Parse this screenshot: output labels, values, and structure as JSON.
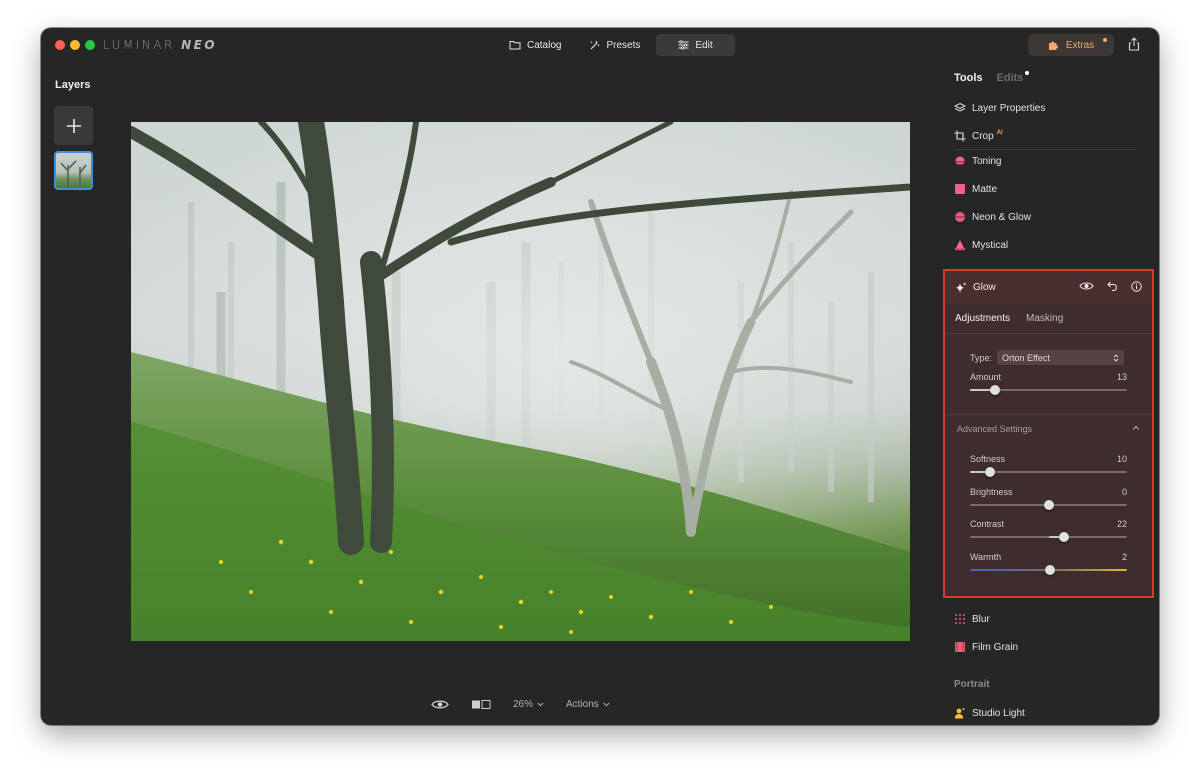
{
  "app": {
    "logo_left": "LUMINAR",
    "logo_right": "NEO"
  },
  "topnav": {
    "catalog": "Catalog",
    "presets": "Presets",
    "edit": "Edit"
  },
  "extras": {
    "label": "Extras"
  },
  "layers": {
    "title": "Layers"
  },
  "view": {
    "zoom": "26%",
    "actions": "Actions"
  },
  "tools_panel": {
    "tab_tools": "Tools",
    "tab_edits": "Edits",
    "items_top": [
      {
        "label": "Layer Properties",
        "icon": "layers-icon"
      },
      {
        "label": "Crop",
        "icon": "crop-icon",
        "badge": "AI"
      },
      {
        "label": "Toning",
        "icon": "toning-icon"
      },
      {
        "label": "Matte",
        "icon": "matte-icon"
      },
      {
        "label": "Neon & Glow",
        "icon": "neon-glow-icon"
      },
      {
        "label": "Mystical",
        "icon": "mystical-icon"
      }
    ],
    "items_bottom": [
      {
        "label": "Blur",
        "icon": "blur-icon"
      },
      {
        "label": "Film Grain",
        "icon": "film-grain-icon"
      }
    ],
    "portrait_section": "Portrait",
    "portrait_items": [
      {
        "label": "Studio Light",
        "icon": "studio-light-icon"
      }
    ]
  },
  "glow": {
    "title": "Glow",
    "tab_adjustments": "Adjustments",
    "tab_masking": "Masking",
    "type_label": "Type:",
    "type_value": "Orton Effect",
    "amount": {
      "label": "Amount",
      "value": "13",
      "position": 0.16
    },
    "advanced_title": "Advanced Settings",
    "advanced": [
      {
        "label": "Softness",
        "value": "10",
        "position": 0.13,
        "center": false
      },
      {
        "label": "Brightness",
        "value": "0",
        "position": 0.5,
        "center": true
      },
      {
        "label": "Contrast",
        "value": "22",
        "position": 0.6,
        "center": true
      },
      {
        "label": "Warmth",
        "value": "2",
        "position": 0.51,
        "center": true,
        "warmth": true
      }
    ]
  },
  "colors": {
    "accent_selected": "#3b8fe0",
    "highlight_border": "#d63a2a",
    "extras_orange": "#f4a86a"
  }
}
